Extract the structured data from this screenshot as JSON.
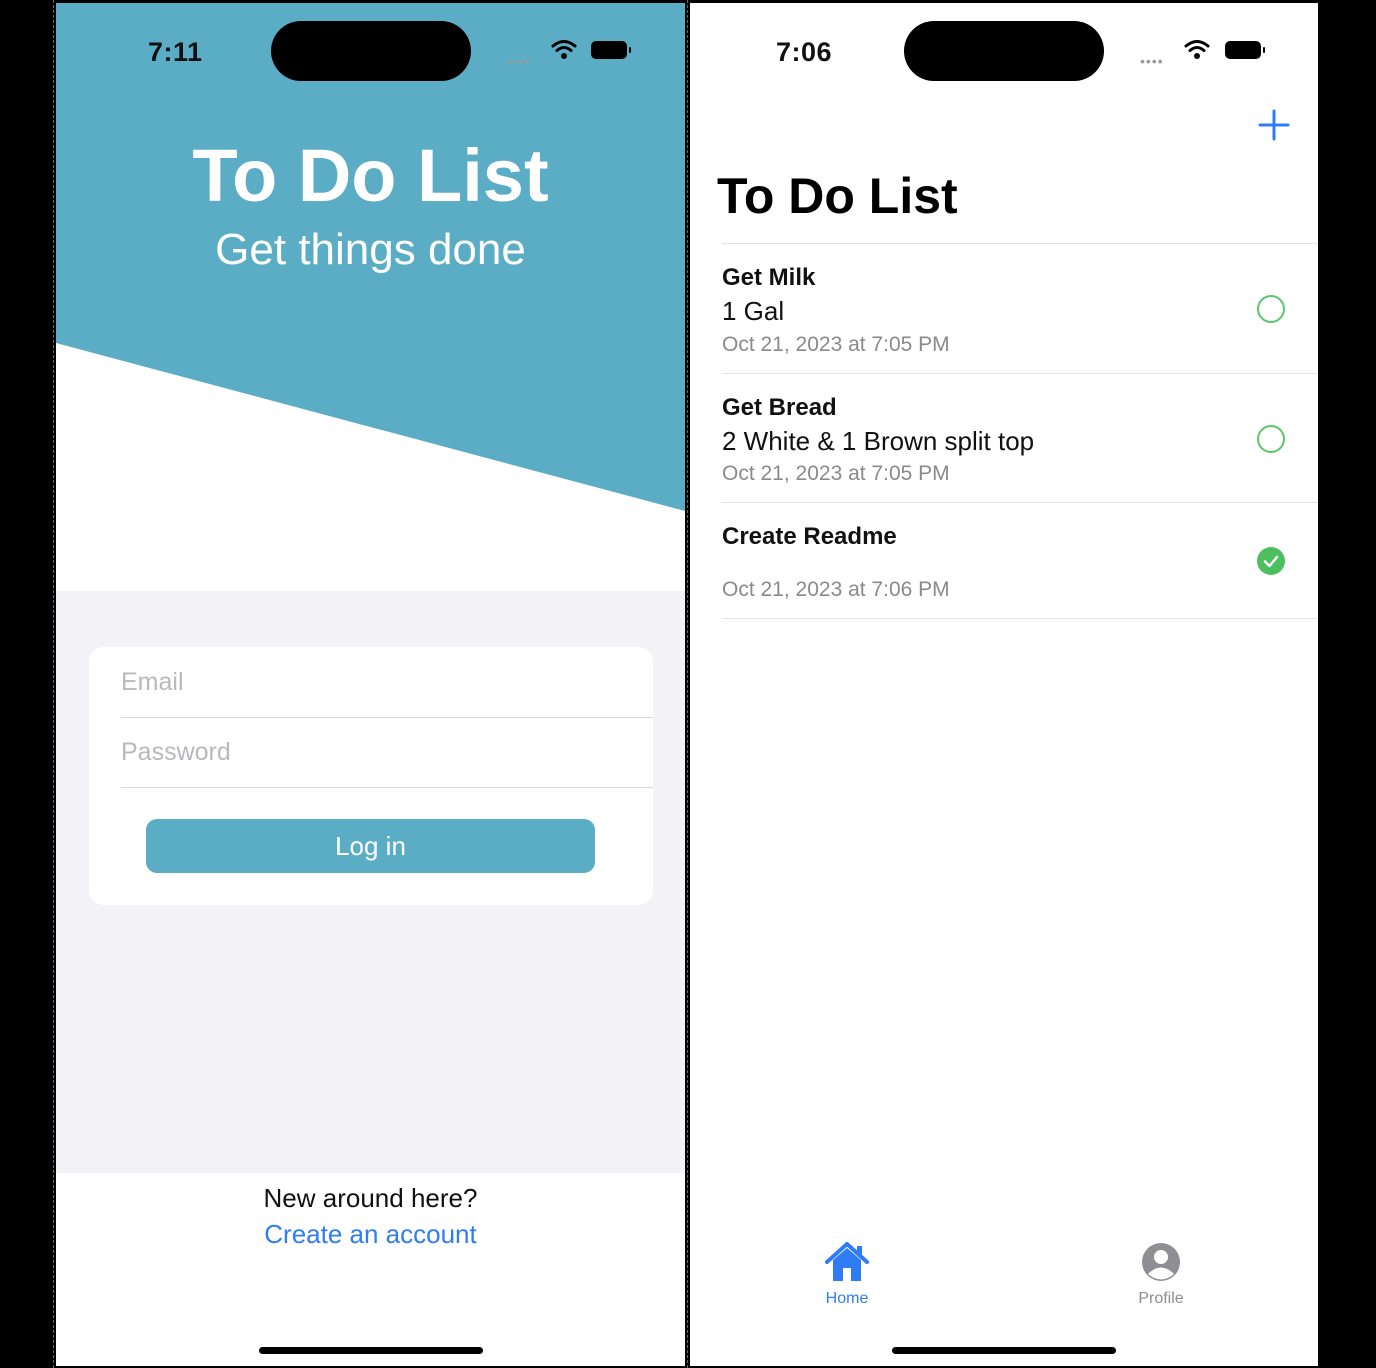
{
  "login": {
    "status_time": "7:11",
    "title": "To Do List",
    "subtitle": "Get things done",
    "email_placeholder": "Email",
    "password_placeholder": "Password",
    "login_label": "Log in",
    "new_text": "New around here?",
    "create_link": "Create an account",
    "accent": "#5badc6"
  },
  "home": {
    "status_time": "7:06",
    "title": "To Do List",
    "items": [
      {
        "title": "Get Milk",
        "note": "1 Gal",
        "date": "Oct 21, 2023 at 7:05 PM",
        "done": false
      },
      {
        "title": "Get Bread",
        "note": "2 White & 1 Brown split top",
        "date": "Oct 21, 2023 at 7:05 PM",
        "done": false
      },
      {
        "title": "Create Readme",
        "note": "",
        "date": "Oct 21, 2023 at 7:06 PM",
        "done": true
      }
    ],
    "tabs": [
      {
        "label": "Home",
        "icon": "house-icon",
        "active": true
      },
      {
        "label": "Profile",
        "icon": "person-circle-icon",
        "active": false
      }
    ]
  }
}
